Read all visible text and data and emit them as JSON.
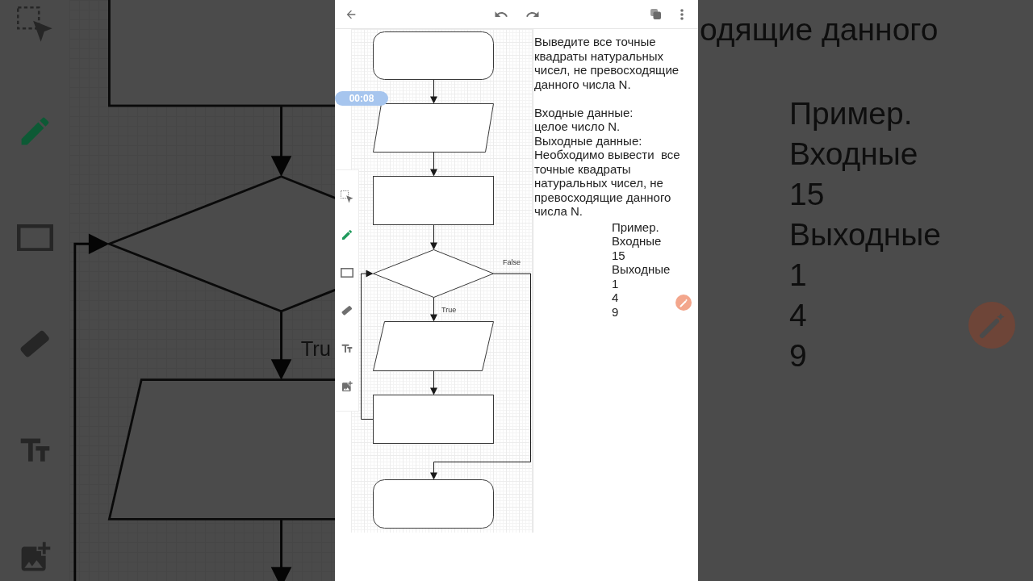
{
  "timer": "00:08",
  "tools": [
    {
      "kind": "select",
      "selected": false
    },
    {
      "kind": "pencil",
      "selected": true
    },
    {
      "kind": "rectangle",
      "selected": false
    },
    {
      "kind": "eraser",
      "selected": false
    },
    {
      "kind": "text",
      "selected": false
    },
    {
      "kind": "image",
      "selected": false
    }
  ],
  "flowchart": {
    "shapes": [
      {
        "kind": "terminal"
      },
      {
        "kind": "io"
      },
      {
        "kind": "process"
      },
      {
        "kind": "decision",
        "true_label": "True",
        "false_label": "False"
      },
      {
        "kind": "io"
      },
      {
        "kind": "process"
      },
      {
        "kind": "terminal"
      }
    ]
  },
  "task": {
    "statement": "Выведите все точные квадраты натуральных чисел, не превосходящие данного числа N.",
    "input_heading": "Входные данные:",
    "input": "целое число N.",
    "output_heading": "Выходные данные:",
    "output": "Необходимо вывести  все точные квадраты натуральных чисел, не превосходящие данного числа N.",
    "example": [
      "Пример.",
      "Входные",
      "15",
      "Выходные",
      "1",
      "4",
      "9"
    ]
  },
  "backdrop_left": {
    "branch_label": "Tru"
  },
  "backdrop_right": {
    "line": "одящие данного",
    "example": [
      "Пример.",
      "Входные",
      "15",
      "Выходные",
      "1",
      "4",
      "9"
    ]
  }
}
